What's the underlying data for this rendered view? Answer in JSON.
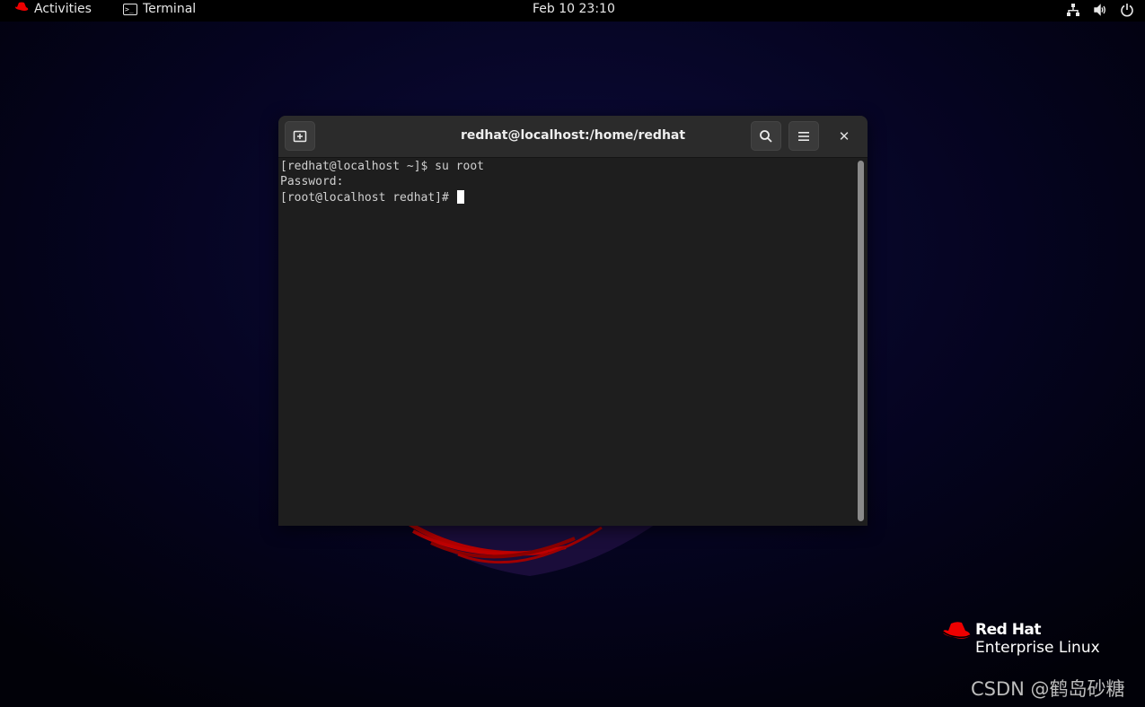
{
  "topbar": {
    "activities_label": "Activities",
    "app_label": "Terminal",
    "clock": "Feb 10  23:10"
  },
  "terminal": {
    "title": "redhat@localhost:/home/redhat",
    "lines": [
      "[redhat@localhost ~]$ su root",
      "Password:",
      "[root@localhost redhat]#"
    ]
  },
  "branding": {
    "line1": "Red Hat",
    "line2": "Enterprise Linux"
  },
  "watermark": "CSDN @鹤岛砂糖",
  "colors": {
    "topbar_bg": "#000000",
    "terminal_bg": "#1e1e1e",
    "header_bg": "#2b2b2b",
    "brand_red": "#ee0000"
  }
}
